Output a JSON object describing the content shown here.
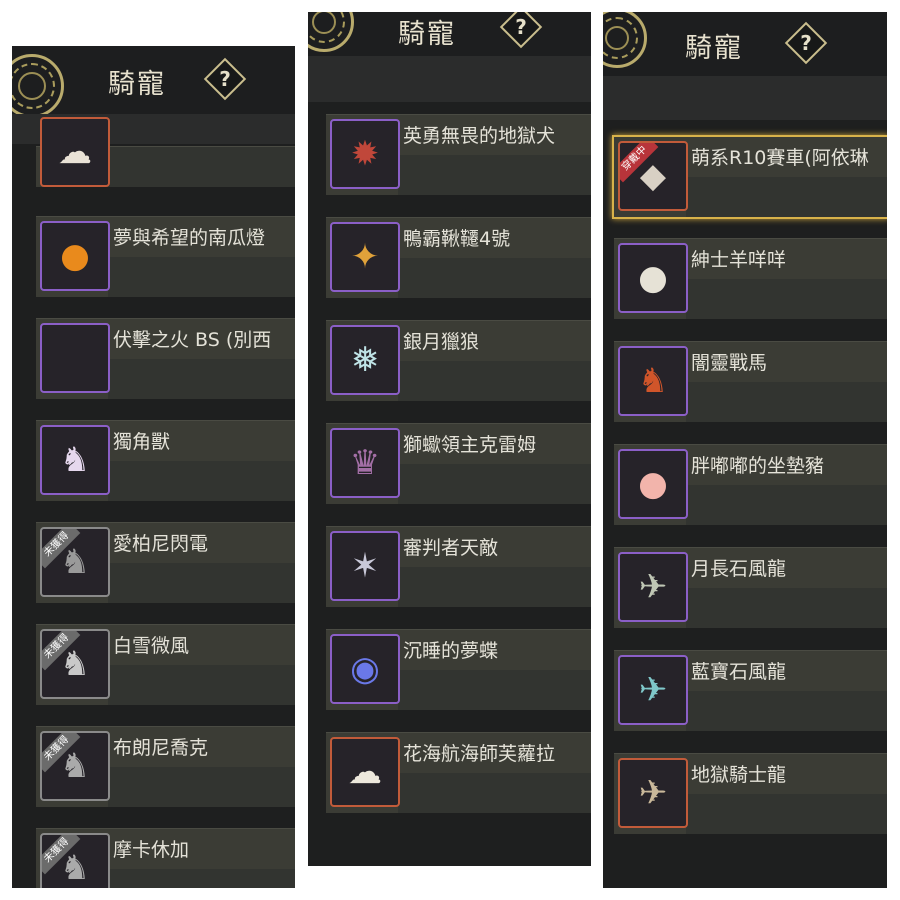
{
  "colors": {
    "accent_gold": "#d8b24a",
    "rare_border": "#8b5fc7",
    "epic_border": "#c25b3a",
    "locked_border": "#8a8a8a"
  },
  "panels": [
    {
      "title": "騎寵",
      "help_label": "?",
      "items": [
        {
          "name": "",
          "icon": "white-mount-icon",
          "border": "orange",
          "badge": ""
        },
        {
          "name": "夢與希望的南瓜燈",
          "icon": "pumpkin-lantern-icon",
          "border": "purple",
          "badge": ""
        },
        {
          "name": "伏擊之火 BS (別西",
          "icon": "empty-slot-icon",
          "border": "purple",
          "badge": ""
        },
        {
          "name": "獨角獸",
          "icon": "unicorn-icon",
          "border": "purple",
          "badge": ""
        },
        {
          "name": "愛柏尼閃電",
          "icon": "horse-icon",
          "border": "gray",
          "badge": "未獲得"
        },
        {
          "name": "白雪微風",
          "icon": "horse-icon",
          "border": "gray",
          "badge": "未獲得"
        },
        {
          "name": "布朗尼喬克",
          "icon": "horse-icon",
          "border": "gray",
          "badge": "未獲得"
        },
        {
          "name": "摩卡休加",
          "icon": "horse-icon",
          "border": "gray",
          "badge": "未獲得"
        }
      ]
    },
    {
      "title": "騎寵",
      "help_label": "?",
      "items": [
        {
          "name": "英勇無畏的地獄犬",
          "icon": "hellhound-icon",
          "border": "purple",
          "badge": ""
        },
        {
          "name": "鴨霸鞦韆4號",
          "icon": "duck-swing-icon",
          "border": "purple",
          "badge": ""
        },
        {
          "name": "銀月獵狼",
          "icon": "silver-wolf-icon",
          "border": "purple",
          "badge": ""
        },
        {
          "name": "獅蠍領主克雷姆",
          "icon": "manticore-icon",
          "border": "purple",
          "badge": ""
        },
        {
          "name": "審判者天敵",
          "icon": "beast-icon",
          "border": "purple",
          "badge": ""
        },
        {
          "name": "沉睡的夢蝶",
          "icon": "dream-orb-icon",
          "border": "purple",
          "badge": ""
        },
        {
          "name": "花海航海師芙蘿拉",
          "icon": "white-whale-icon",
          "border": "orange",
          "badge": ""
        }
      ]
    },
    {
      "title": "騎寵",
      "help_label": "?",
      "items": [
        {
          "name": "萌系R10賽車(阿依琳",
          "icon": "race-car-icon",
          "border": "orange",
          "badge": "穿戴中"
        },
        {
          "name": "紳士羊咩咩",
          "icon": "sheep-icon",
          "border": "purple",
          "badge": ""
        },
        {
          "name": "闇靈戰馬",
          "icon": "fire-horse-icon",
          "border": "purple",
          "badge": ""
        },
        {
          "name": "胖嘟嘟的坐墊豬",
          "icon": "pig-icon",
          "border": "purple",
          "badge": ""
        },
        {
          "name": "月長石風龍",
          "icon": "wind-dragon-icon",
          "border": "purple",
          "badge": ""
        },
        {
          "name": "藍寶石風龍",
          "icon": "wind-dragon-icon",
          "border": "purple",
          "badge": ""
        },
        {
          "name": "地獄騎士龍",
          "icon": "hell-dragon-icon",
          "border": "orange",
          "badge": ""
        }
      ]
    }
  ]
}
